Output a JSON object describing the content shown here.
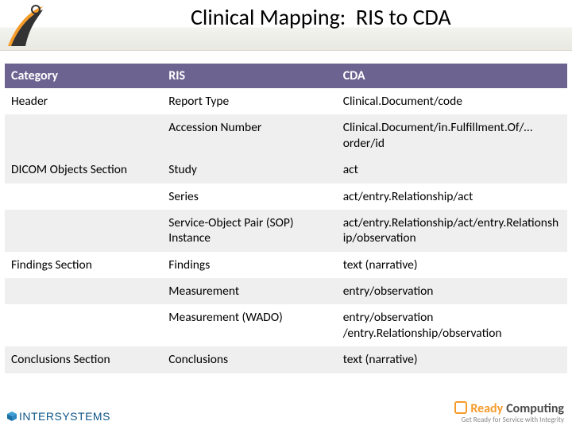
{
  "title": "Clinical Mapping:  RIS to CDA",
  "table": {
    "headers": {
      "c1": "Category",
      "c2": "RIS",
      "c3": "CDA"
    },
    "rows": [
      {
        "band": "a",
        "c1": "Header",
        "c2": "Report Type",
        "c3": "Clinical.Document/code"
      },
      {
        "band": "b",
        "c1": "",
        "c2": "Accession Number",
        "c3": "Clinical.Document/in.Fulfillment.Of/…order/id"
      },
      {
        "band": "b",
        "c1": "DICOM Objects Section",
        "c2": "Study",
        "c3": "act"
      },
      {
        "band": "a",
        "c1": "",
        "c2": "Series",
        "c3": "act/entry.Relationship/act"
      },
      {
        "band": "b",
        "c1": "",
        "c2": "Service-Object Pair (SOP) Instance",
        "c3": "act/entry.Relationship/act/entry.Relationship/observation"
      },
      {
        "band": "a",
        "c1": "Findings Section",
        "c2": "Findings",
        "c3": "text (narrative)"
      },
      {
        "band": "b",
        "c1": "",
        "c2": "Measurement",
        "c3": "entry/observation"
      },
      {
        "band": "a",
        "c1": "",
        "c2": "Measurement (WADO)",
        "c3": "entry/observation /entry.Relationship/observation"
      },
      {
        "band": "b",
        "c1": "Conclusions Section",
        "c2": "Conclusions",
        "c3": "text (narrative)"
      }
    ]
  },
  "footer": {
    "left_brand": "INTERSYSTEMS",
    "right_brand_a": "Ready",
    "right_brand_b": "Computing",
    "right_tag": "Get Ready for Service with Integrity"
  }
}
